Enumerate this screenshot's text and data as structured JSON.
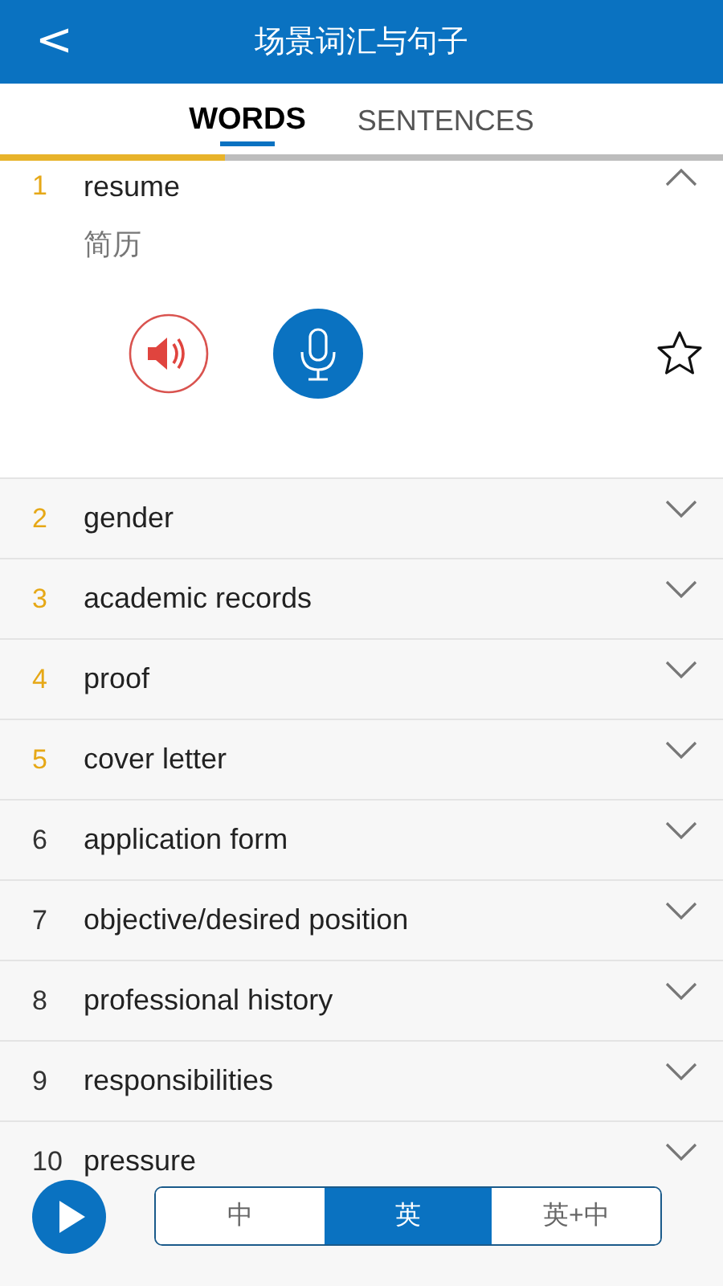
{
  "header": {
    "back": "<",
    "title": "场景词汇与句子"
  },
  "tabs": [
    {
      "label": "WORDS",
      "selected": true
    },
    {
      "label": "SENTENCES",
      "selected": false
    }
  ],
  "progress": {
    "level": 0.31
  },
  "words": [
    {
      "number": "1",
      "word": "resume",
      "translation": "简历",
      "expanded": true,
      "color": "#e6a817",
      "starred": false
    },
    {
      "number": "2",
      "word": "gender",
      "expanded": false,
      "color": "#e6a817"
    },
    {
      "number": "3",
      "word": "academic records",
      "expanded": false,
      "color": "#e6a817"
    },
    {
      "number": "4",
      "word": "proof",
      "expanded": false,
      "color": "#e6a817"
    },
    {
      "number": "5",
      "word": "cover letter",
      "expanded": false,
      "color": "#e6a817"
    },
    {
      "number": "6",
      "word": "application form",
      "expanded": false,
      "color": "#333333"
    },
    {
      "number": "7",
      "word": "objective/desired position",
      "expanded": false,
      "color": "#333333"
    },
    {
      "number": "8",
      "word": "professional history",
      "expanded": false,
      "color": "#333333"
    },
    {
      "number": "9",
      "word": "responsibilities",
      "expanded": false,
      "color": "#333333"
    },
    {
      "number": "10",
      "word": "pressure",
      "expanded": false,
      "color": "#333333"
    }
  ],
  "modes": [
    {
      "label": "中",
      "selected": false
    },
    {
      "label": "英",
      "selected": true
    },
    {
      "label": "英+中",
      "selected": false
    }
  ]
}
